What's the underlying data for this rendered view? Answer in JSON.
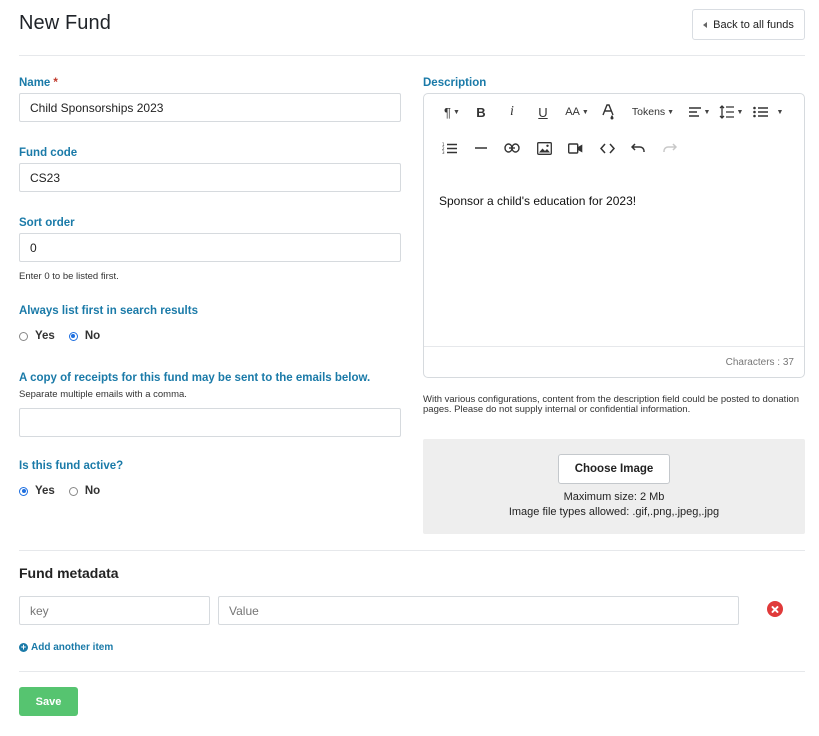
{
  "page": {
    "title": "New Fund",
    "back_label": "Back to all funds"
  },
  "form": {
    "name": {
      "label": "Name",
      "required_mark": "*",
      "value": "Child Sponsorships 2023"
    },
    "fund_code": {
      "label": "Fund code",
      "value": "CS23"
    },
    "sort_order": {
      "label": "Sort order",
      "value": "0",
      "help": "Enter 0 to be listed first."
    },
    "list_first": {
      "label": "Always list first in search results",
      "options": [
        "Yes",
        "No"
      ],
      "selected": "No"
    },
    "receipt_emails": {
      "label": "A copy of receipts for this fund may be sent to the emails below.",
      "help": "Separate multiple emails with a comma.",
      "value": ""
    },
    "active": {
      "label": "Is this fund active?",
      "options": [
        "Yes",
        "No"
      ],
      "selected": "Yes"
    }
  },
  "description": {
    "label": "Description",
    "content": "Sponsor a child's education for 2023!",
    "character_count": "Characters : 37",
    "note": "With various configurations, content from the description field could be posted to donation pages. Please do not supply internal or confidential information.",
    "toolbar": {
      "paragraph": "¶",
      "bold": "B",
      "italic": "i",
      "underline": "U",
      "font_size": "AA",
      "tokens": "Tokens"
    }
  },
  "image_upload": {
    "button_label": "Choose Image",
    "max_size": "Maximum size: 2 Mb",
    "file_types": "Image file types allowed: .gif,.png,.jpeg,.jpg"
  },
  "metadata": {
    "title": "Fund metadata",
    "key_placeholder": "key",
    "value_placeholder": "Value",
    "add_label": "Add another item"
  },
  "actions": {
    "save_label": "Save"
  },
  "colors": {
    "accent": "#1a7aa8",
    "save": "#56c470",
    "danger": "#e03a3a",
    "radio": "#1e6fe0"
  }
}
